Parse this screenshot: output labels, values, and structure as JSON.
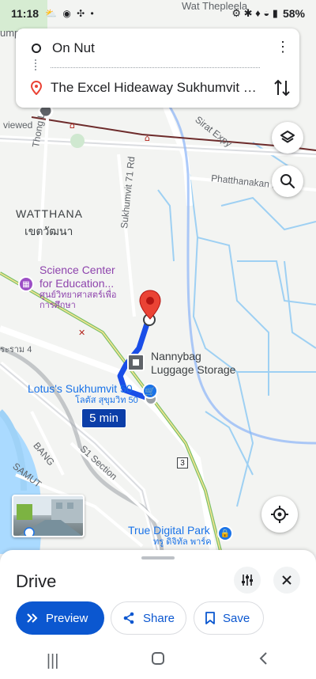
{
  "status_bar": {
    "time": "11:18",
    "battery": "58%"
  },
  "route": {
    "origin": "On Nut",
    "destination": "The Excel Hideaway Sukhumvit 71,..."
  },
  "map_labels": {
    "area_top": "Wat Thepleela",
    "lumpini": "umpini Park",
    "viewed": "viewed",
    "thong_lo": "Thong Lo",
    "watthana_en": "WATTHANA",
    "watthana_th": "เขตวัฒนา",
    "sukhumvit71": "Sukhumvit 71 Rd",
    "phatthanakan": "Phatthanakan R",
    "sirat_expy": "Sirat Expy",
    "section": "S1 Section",
    "samut": "SAMUT",
    "bang": "BANG",
    "rama4": "ระราม 4"
  },
  "pois": {
    "science_center_en": "Science Center for Education...",
    "science_center_th": "ศูนย์วิทยาศาสตร์เพื่อการศึกษา",
    "nannybag": "Nannybag Luggage Storage",
    "lotus_en": "Lotus's Sukhumvit 50",
    "lotus_th": "โลตัส สุขุมวิท 50",
    "true_digital_en": "True Digital Park",
    "true_digital_th": "ทรู ดิจิทัล พาร์ค"
  },
  "route_badge": {
    "eta": "5 min",
    "road_shield": "3"
  },
  "bottom_sheet": {
    "title": "Drive",
    "preview_label": "Preview",
    "share_label": "Share",
    "save_label": "Save"
  },
  "colors": {
    "route_blue": "#1a4ee8",
    "button_blue": "#0b57d0",
    "pin_red": "#ea4335"
  }
}
